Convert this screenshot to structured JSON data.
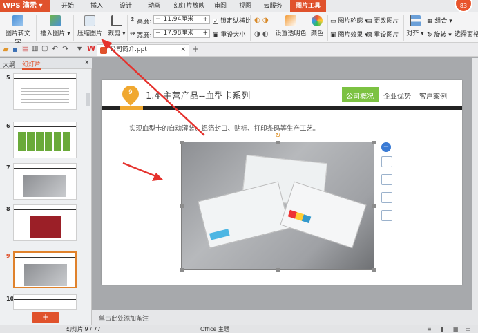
{
  "app": {
    "name": "WPS 演示",
    "avatar_text": "83"
  },
  "tabs": [
    "开始",
    "插入",
    "设计",
    "动画",
    "幻灯片放映",
    "审阅",
    "视图",
    "云服务",
    "图片工具"
  ],
  "active_tab": "图片工具",
  "ribbon": {
    "pic_to_text": "图片转文字",
    "insert_pic": "插入图片",
    "compress": "压缩图片",
    "crop": "裁剪",
    "height_label": "高度:",
    "height_value": "11.94厘米",
    "width_label": "宽度:",
    "width_value": "17.98厘米",
    "lock_ratio": "锁定纵横比",
    "reset_size": "重设大小",
    "transparent": "设置透明色",
    "color": "颜色",
    "outline": "图片轮廓",
    "effect": "图片效果",
    "change_pic": "更改图片",
    "reset_pic": "重设图片",
    "align": "对齐",
    "group": "组合",
    "rotate": "旋转",
    "select_pane": "选择窗格"
  },
  "document_tab": "公司简介.ppt",
  "left_pane": {
    "outline_tab": "大纲",
    "slides_tab": "幻灯片",
    "slide_numbers": [
      "5",
      "6",
      "7",
      "8",
      "9",
      "10"
    ],
    "selected": "9"
  },
  "slide": {
    "badge": "9",
    "title": "1.4 主营产品--血型卡系列",
    "nav": [
      "公司概况",
      "企业优势",
      "客户案例"
    ],
    "nav_active": "公司概况",
    "subtitle": "实现血型卡的自动灌装、铝箔封口、贴标、打印条码等生产工艺。"
  },
  "notes_placeholder": "单击此处添加备注",
  "status": {
    "slide_count": "幻灯片 9 / 77",
    "theme": "Office 主题"
  },
  "colors": {
    "accent": "#e0522c",
    "green": "#7cc242",
    "orange": "#f0a830",
    "arrow": "#e5322d"
  }
}
